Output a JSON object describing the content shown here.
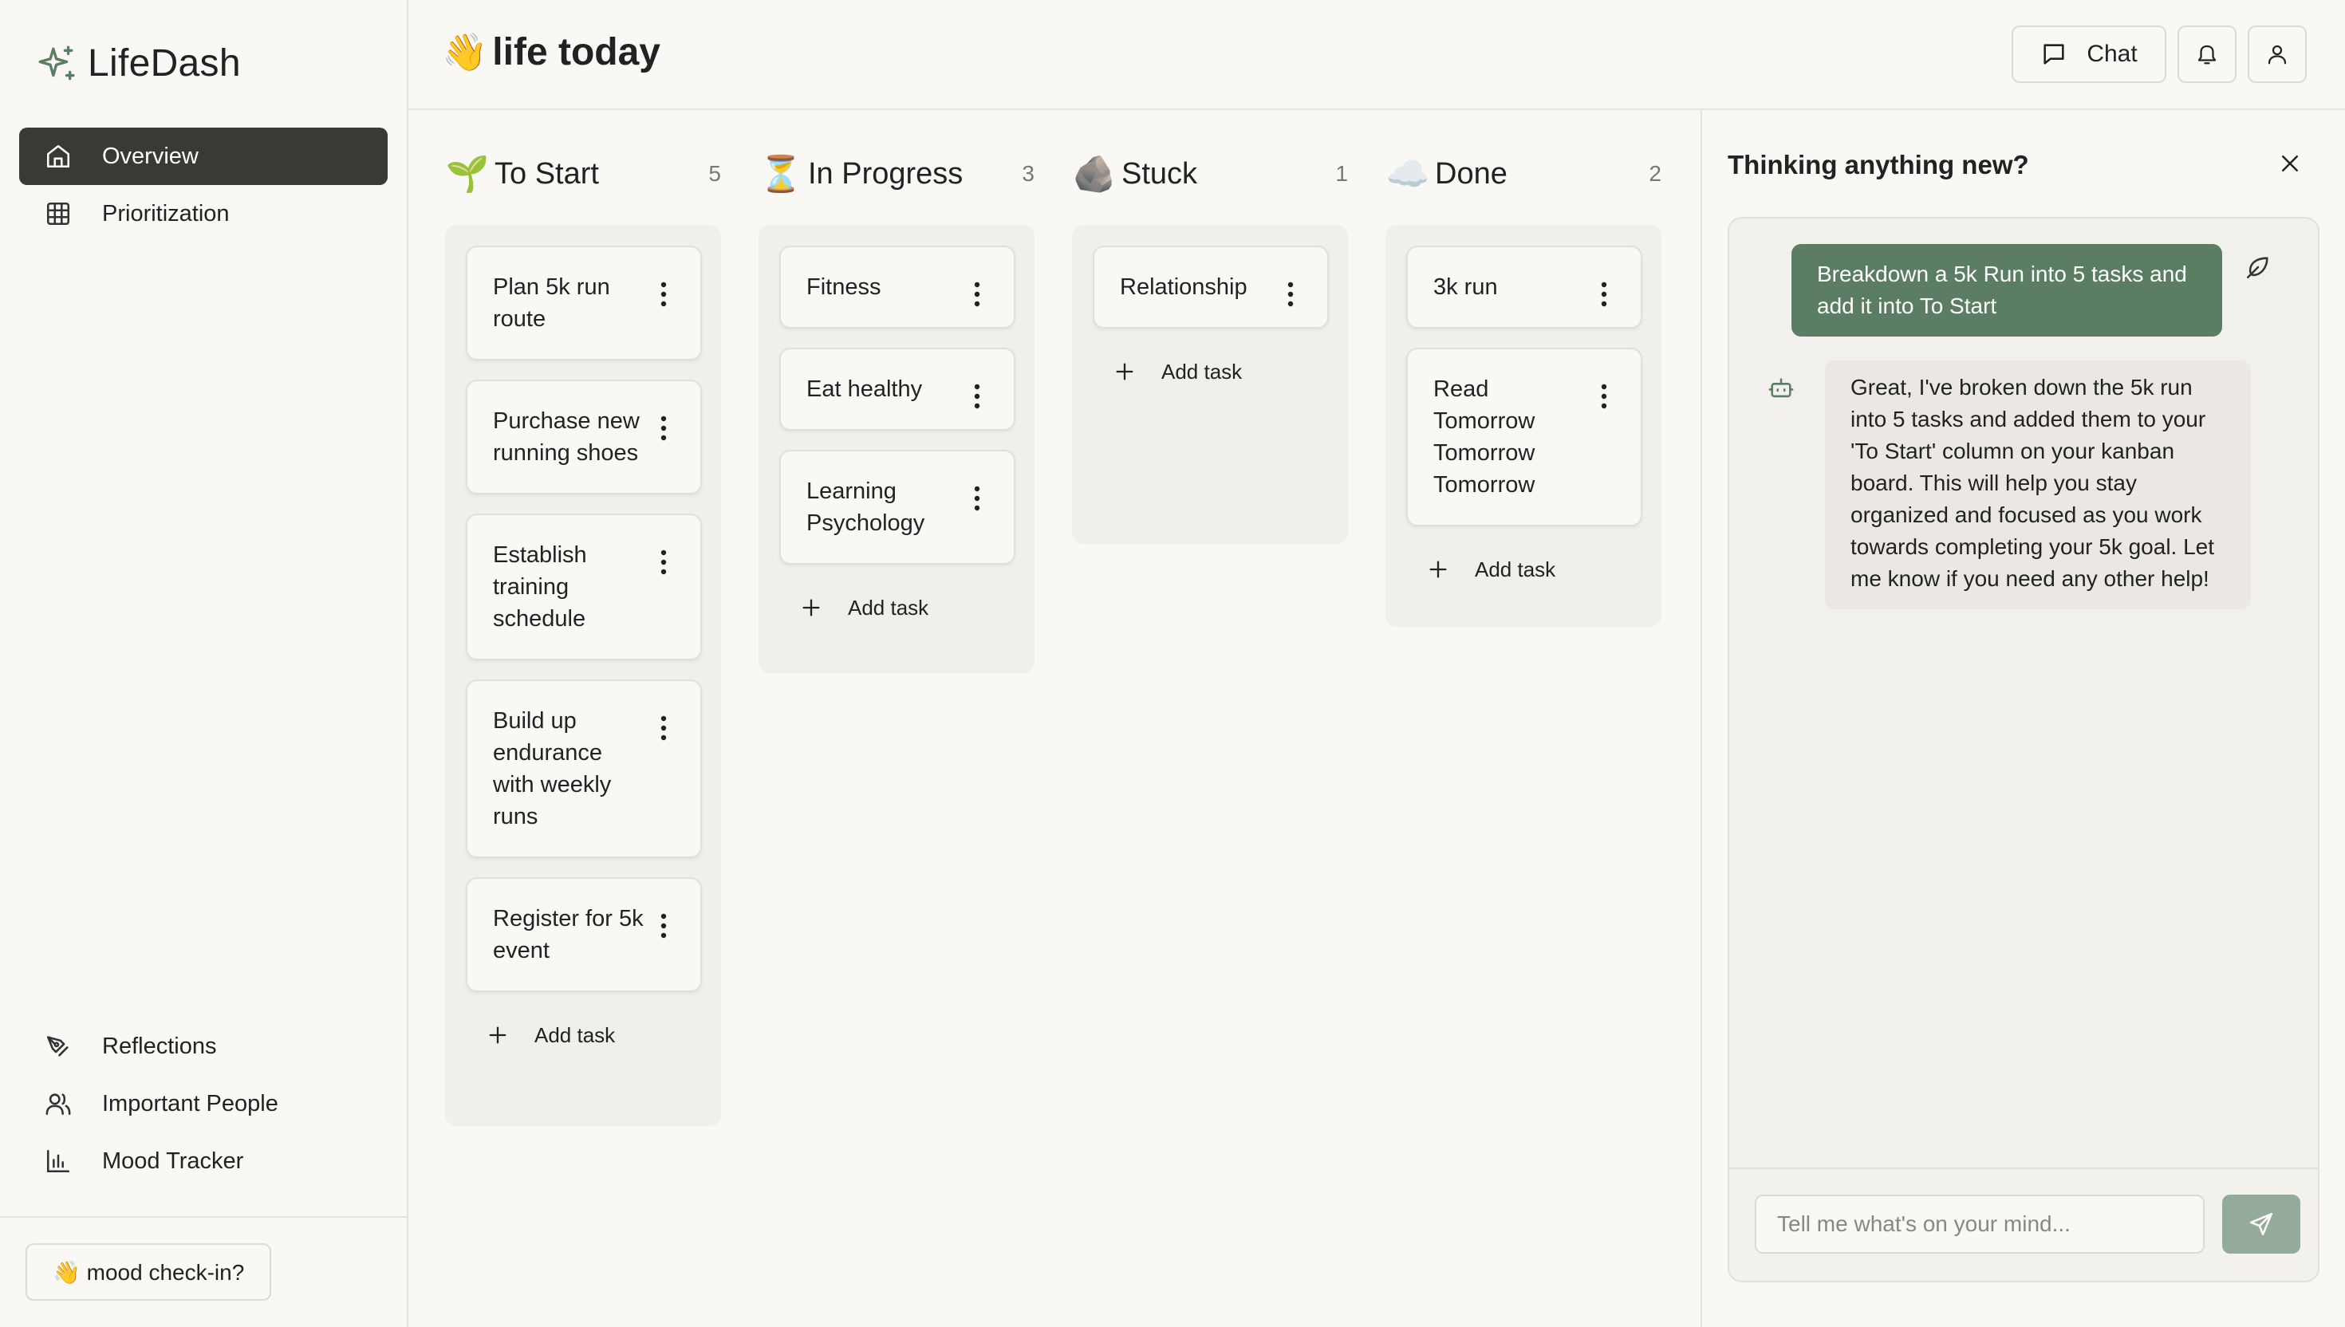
{
  "app": {
    "name": "LifeDash"
  },
  "sidebar": {
    "nav": [
      {
        "label": "Overview",
        "icon": "home-icon",
        "active": true
      },
      {
        "label": "Prioritization",
        "icon": "grid-icon",
        "active": false
      }
    ],
    "bottom_nav": [
      {
        "label": "Reflections",
        "icon": "pen-icon"
      },
      {
        "label": "Important People",
        "icon": "people-icon"
      },
      {
        "label": "Mood Tracker",
        "icon": "bar-chart-icon"
      }
    ],
    "mood_checkin": "👋 mood check-in?"
  },
  "header": {
    "title_emoji": "👋",
    "title": "life today",
    "chat_label": "Chat"
  },
  "board": {
    "add_task_label": "Add task",
    "columns": [
      {
        "emoji": "🌱",
        "title": "To Start",
        "count": "5",
        "cards": [
          "Plan 5k run route",
          "Purchase new running shoes",
          "Establish training schedule",
          "Build up endurance with weekly runs",
          "Register for 5k event"
        ]
      },
      {
        "emoji": "⏳",
        "title": "In Progress",
        "count": "3",
        "cards": [
          "Fitness",
          "Eat healthy",
          "Learning Psychology"
        ]
      },
      {
        "emoji": "🪨",
        "title": "Stuck",
        "count": "1",
        "cards": [
          "Relationship"
        ]
      },
      {
        "emoji": "☁️",
        "title": "Done",
        "count": "2",
        "cards": [
          "3k run",
          "Read Tomorrow Tomorrow Tomorrow"
        ]
      }
    ]
  },
  "chat": {
    "title": "Thinking anything new?",
    "user_message": "Breakdown a 5k Run into 5 tasks and add it into To Start",
    "bot_message": "Great, I've broken down the 5k run into 5 tasks and added them to your 'To Start' column on your kanban board. This will help you stay organized and focused as you work towards completing your 5k goal. Let me know if you need any other help!",
    "input_placeholder": "Tell me what's on your mind...",
    "accent": "#5a7d63"
  }
}
